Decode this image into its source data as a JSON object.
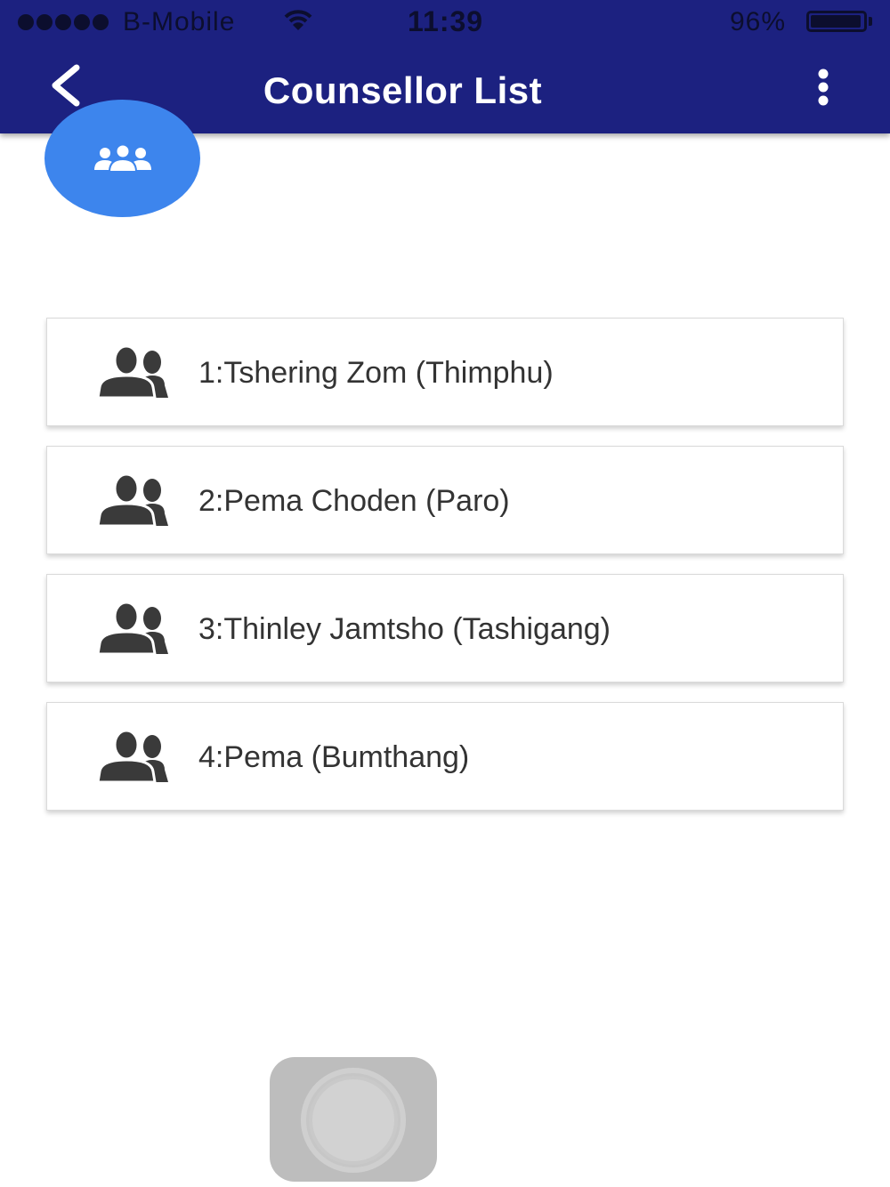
{
  "status_bar": {
    "carrier": "B-Mobile",
    "time": "11:39",
    "battery_percent": "96%",
    "battery_level": 0.96,
    "signal_bars": 5,
    "wifi_icon": "wifi-icon"
  },
  "header": {
    "title": "Counsellor List",
    "back_icon": "chevron-left-icon",
    "menu_icon": "more-vertical-icon"
  },
  "fab": {
    "icon": "group-icon"
  },
  "counsellors": [
    {
      "label": "1:Tshering Zom (Thimphu)",
      "icon": "users-icon"
    },
    {
      "label": "2:Pema Choden (Paro)",
      "icon": "users-icon"
    },
    {
      "label": "3:Thinley Jamtsho (Tashigang)",
      "icon": "users-icon"
    },
    {
      "label": "4:Pema (Bumthang)",
      "icon": "users-icon"
    }
  ],
  "colors": {
    "header_bg": "#1c2180",
    "fab_bg": "#3d85ed",
    "icon": "#3a3a3a",
    "text": "#333333"
  }
}
